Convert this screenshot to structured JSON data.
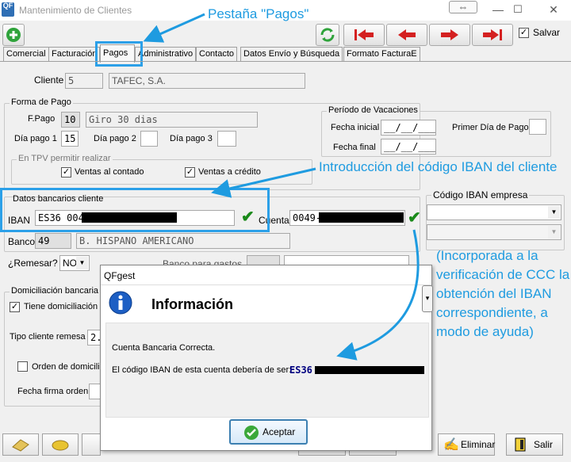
{
  "window": {
    "title": "Mantenimiento de Clientes",
    "app_icon_text": "QF",
    "restore_symbol": "⇔",
    "minimize_symbol": "—",
    "maximize_symbol": "☐",
    "close_symbol": "✕"
  },
  "toolbar": {
    "salvar_label": "Salvar",
    "salvar_checked": true
  },
  "tabs": [
    "Comercial",
    "Facturación",
    "Pagos",
    "Administrativo",
    "Contacto",
    "Datos Envío y Búsqueda",
    "Formato FacturaE"
  ],
  "active_tab": "Pagos",
  "cliente": {
    "label": "Cliente",
    "code": "5",
    "name": "TAFEC, S.A."
  },
  "forma_pago": {
    "group": "Forma de Pago",
    "fpago_label": "F.Pago",
    "fpago_code": "10",
    "fpago_desc": "Giro 30 dias",
    "dia1_label": "Día pago 1",
    "dia1": "15",
    "dia2_label": "Día pago 2",
    "dia3_label": "Día pago 3",
    "tpv_group": "En TPV permitir realizar",
    "contado_label": "Ventas al contado",
    "credito_label": "Ventas a crédito"
  },
  "vacaciones": {
    "group": "Período de Vacaciones",
    "inicial_label": "Fecha inicial",
    "final_label": "Fecha final",
    "date_mask": "__/__/____",
    "primer_dia_label": "Primer Día de Pago"
  },
  "bancarios": {
    "group": "Datos bancarios cliente",
    "iban_label": "IBAN",
    "iban_value": "ES36 0049",
    "cuenta_label": "Cuenta",
    "cuenta_value": "0049-",
    "banco_label": "Banco",
    "banco_code": "49",
    "banco_name": "B. HISPANO AMERICANO",
    "remesar_label": "¿Remesar?",
    "remesar_value": "NO",
    "gastos_label": "Banco para gastos"
  },
  "iban_empresa": {
    "group": "Código IBAN empresa"
  },
  "domiciliacion": {
    "group": "Domiciliación bancaria",
    "tiene_label": "Tiene domiciliación b",
    "tipo_label": "Tipo cliente remesa",
    "tipo_value": "2.",
    "orden_label": "Orden de domicilia",
    "fecha_label": "Fecha firma orden"
  },
  "annotations": {
    "pestana": "Pestaña \"Pagos\"",
    "introduccion": "Introducción del código IBAN del cliente",
    "incorporada": [
      "(Incorporada a la",
      "verificación de CCC la",
      "obtención del IBAN",
      "correspondiente, a",
      "modo de ayuda)"
    ]
  },
  "dialog": {
    "title": "QFgest",
    "heading": "Información",
    "line1": "Cuenta Bancaria Correcta.",
    "line2": "El código IBAN de esta cuenta debería de ser:",
    "iban": "ES36",
    "ok_button": "Aceptar"
  },
  "bottom": {
    "eliminar": "Eliminar",
    "salir": "Salir"
  },
  "colors": {
    "annotation": "#1e9be0",
    "highlight": "#2ca0e8",
    "nav_arrow": "#d42020",
    "iban_blue": "#000080"
  }
}
